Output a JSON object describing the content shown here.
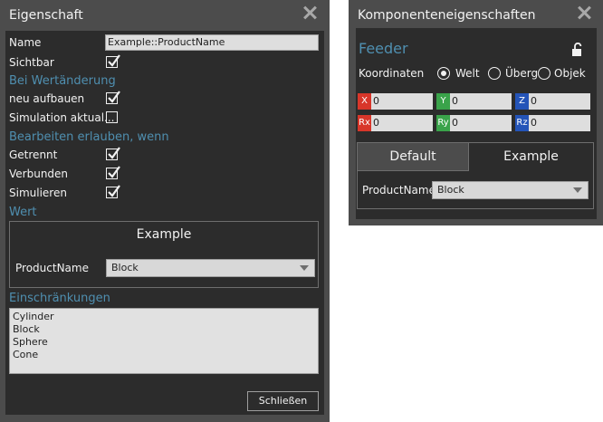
{
  "left": {
    "title": "Eigenschaft",
    "name_label": "Name",
    "name_value": "Example::ProductName",
    "sichtbar_label": "Sichtbar",
    "section_change": "Bei Wertänderung",
    "rebuild_label": "neu aufbauen",
    "sim_update_label": "Simulation aktual...",
    "section_edit": "Bearbeiten erlauben, wenn",
    "disconnected_label": "Getrennt",
    "connected_label": "Verbunden",
    "simulating_label": "Simulieren",
    "section_value": "Wert",
    "value_header": "Example",
    "product_label": "ProductName",
    "product_value": "Block",
    "section_constraints": "Einschränkungen",
    "constraints": [
      "Cylinder",
      "Block",
      "Sphere",
      "Cone"
    ],
    "close_button": "Schließen"
  },
  "right": {
    "title": "Komponenteneigenschaften",
    "component_name": "Feeder",
    "coords_label": "Koordinaten",
    "radio_world": "Welt",
    "radio_parent": "Überg",
    "radio_object": "Objek",
    "x_tag": "X",
    "x_val": "0",
    "y_tag": "Y",
    "y_val": "0",
    "z_tag": "Z",
    "z_val": "0",
    "rx_tag": "Rx",
    "rx_val": "0",
    "ry_tag": "Ry",
    "ry_val": "0",
    "rz_tag": "Rz",
    "rz_val": "0",
    "tab_default": "Default",
    "tab_example": "Example",
    "product_label": "ProductName",
    "product_value": "Block"
  },
  "colors": {
    "panel_bg": "#4c4c4c",
    "inner_bg": "#2c2c2c",
    "section_blue": "#4f8fb0",
    "x_red": "#d8362a",
    "y_green": "#3aa34a",
    "z_blue": "#2454b8"
  }
}
